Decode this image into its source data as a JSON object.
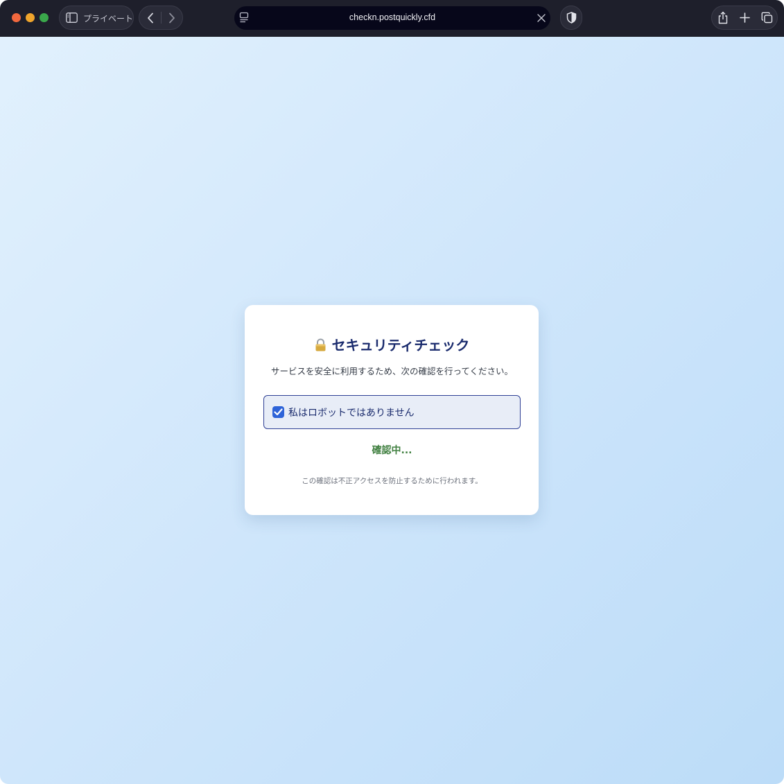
{
  "browser": {
    "private_label": "プライベート",
    "url": "checkn.postquickly.cfd"
  },
  "icons": {
    "sidebar": "sidebar-icon",
    "back": "chevron-left-icon",
    "forward": "chevron-right-icon",
    "reader": "reader-icon",
    "clear": "close-icon",
    "shield": "shield-icon",
    "share": "share-icon",
    "new_tab": "plus-icon",
    "tabs": "tabs-overview-icon",
    "lock": "lock-icon"
  },
  "card": {
    "title": "セキュリティチェック",
    "description": "サービスを安全に利用するため、次の確認を行ってください。",
    "checkbox_label": "私はロボットではありません",
    "checkbox_checked": true,
    "status": "確認中...",
    "footnote": "この確認は不正アクセスを防止するために行われます。"
  },
  "colors": {
    "title": "#1a2b6d",
    "status": "#3f7f3f",
    "checkbox": "#2e63d8"
  }
}
